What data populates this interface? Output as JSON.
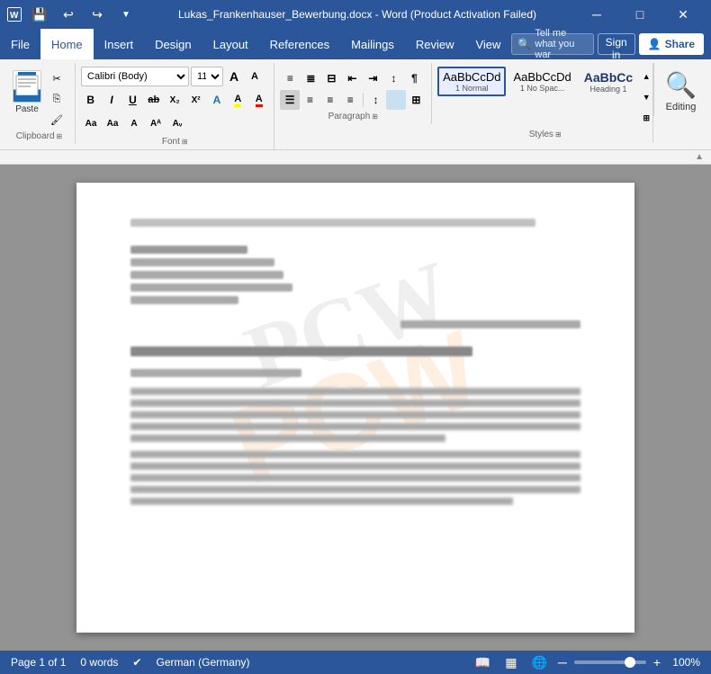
{
  "titlebar": {
    "title": "Lukas_Frankenhauser_Bewerbung.docx - Word (Product Activation Failed)",
    "save_icon": "💾",
    "undo_icon": "↩",
    "redo_icon": "↪",
    "customize_icon": "▼",
    "minimize": "─",
    "restore": "□",
    "close": "✕"
  },
  "menubar": {
    "items": [
      "File",
      "Home",
      "Insert",
      "Design",
      "Layout",
      "References",
      "Mailings",
      "Review",
      "View"
    ],
    "active": "Home",
    "search_placeholder": "Tell me what you war",
    "sign_in": "Sign in",
    "share": "Share"
  },
  "ribbon": {
    "clipboard": {
      "label": "Clipboard",
      "paste": "Paste",
      "cut": "✂",
      "copy": "⎘",
      "format_painter": "🖌"
    },
    "font": {
      "label": "Font",
      "name": "Calibri (Body)",
      "size": "11",
      "bold": "B",
      "italic": "I",
      "underline": "U",
      "strikethrough": "ab",
      "subscript": "X₂",
      "superscript": "X²",
      "text_effects": "A",
      "highlight": "A",
      "font_color": "A",
      "grow": "A↑",
      "shrink": "A↓",
      "clear": "Aa",
      "case": "Aa",
      "small_case": "A"
    },
    "paragraph": {
      "label": "Paragraph"
    },
    "styles": {
      "label": "Styles",
      "items": [
        {
          "name": "1 Normal",
          "preview": "AaBbCcDd",
          "active": true
        },
        {
          "name": "1 No Spac...",
          "preview": "AaBbCcDd"
        },
        {
          "name": "Heading 1",
          "preview": "AaBbCc"
        }
      ]
    },
    "editing": {
      "label": "Editing",
      "icon": "🔍"
    }
  },
  "document": {
    "watermark": "PCW"
  },
  "statusbar": {
    "page": "Page 1 of 1",
    "words": "0 words",
    "language": "German (Germany)",
    "zoom": "100%",
    "zoom_percent": 100
  }
}
